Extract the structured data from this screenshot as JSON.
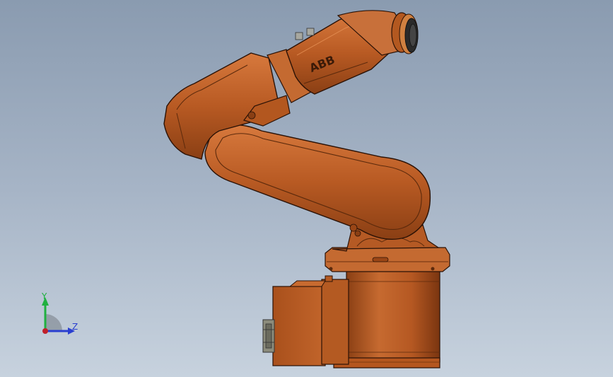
{
  "model": {
    "brand_label": "ABB",
    "body_color": "#c0622a",
    "body_shadow": "#7d3a12",
    "outline_color": "#2b1206",
    "flange_color": "#2a2a2a"
  },
  "triad": {
    "y_label": "Y",
    "z_label": "Z",
    "y_color": "#20b040",
    "z_color": "#2a3fd0",
    "origin_color": "#c0202a"
  }
}
